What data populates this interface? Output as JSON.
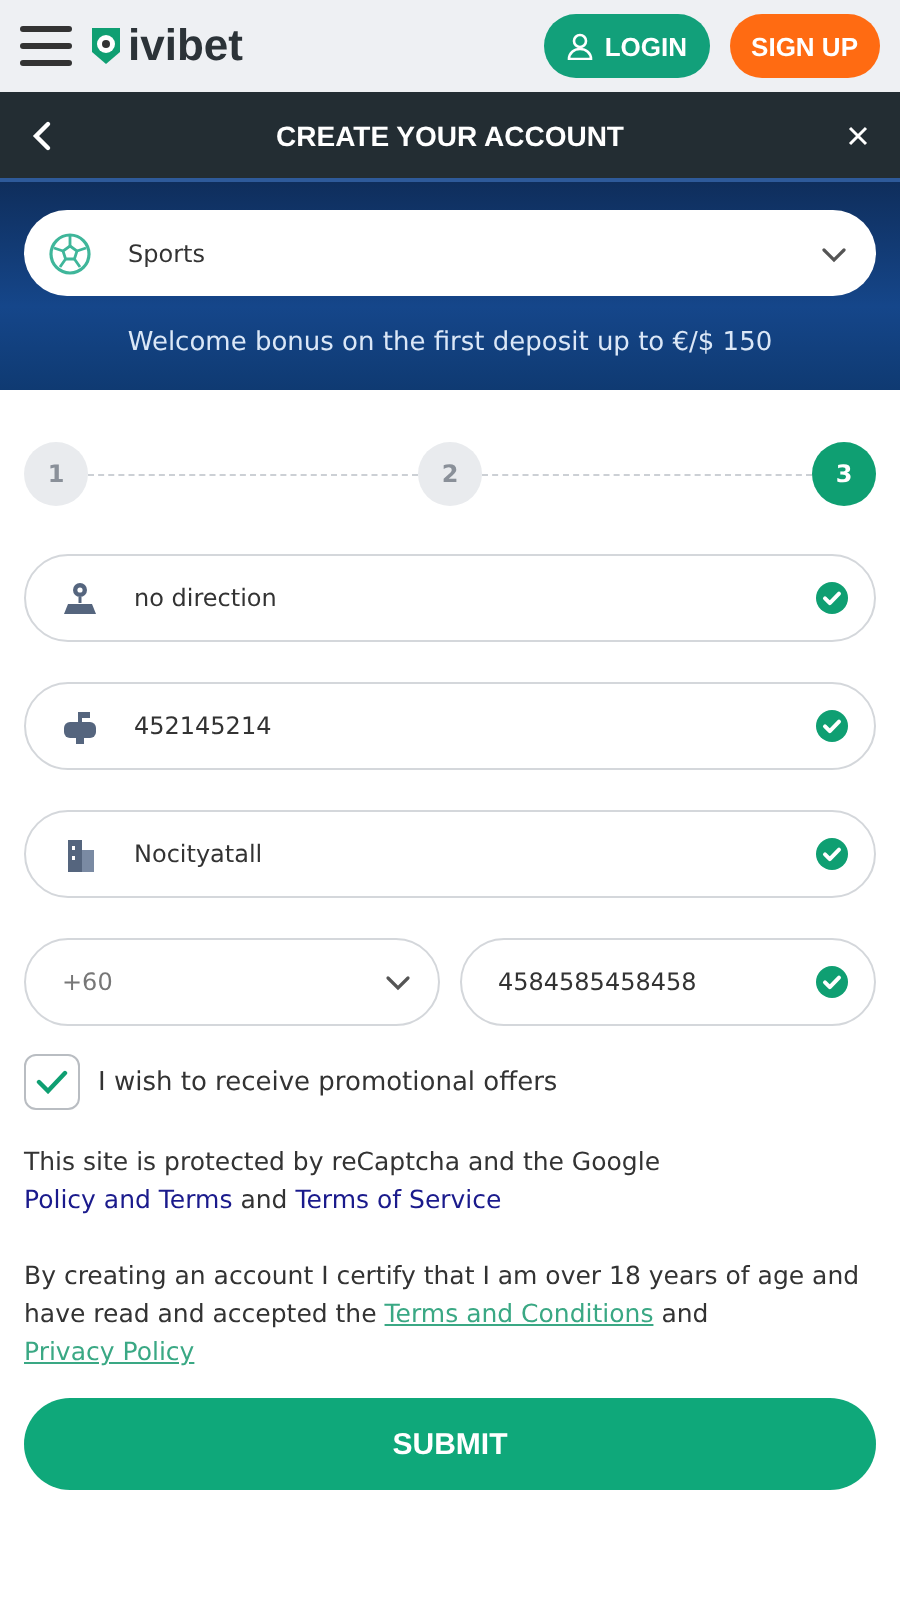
{
  "header": {
    "logo": "ivibet",
    "login": "LOGIN",
    "signup": "SIGN UP"
  },
  "title_bar": {
    "title": "CREATE YOUR ACCOUNT"
  },
  "bonus": {
    "select_value": "Sports",
    "text": "Welcome bonus on the first deposit up to €/$ 150"
  },
  "steps": [
    {
      "label": "1",
      "selected": false
    },
    {
      "label": "2",
      "selected": false
    },
    {
      "label": "3",
      "selected": true
    }
  ],
  "fields": [
    {
      "kind": "location",
      "value": "no direction",
      "valid": true
    },
    {
      "kind": "mailbox",
      "value": "452145214",
      "valid": true
    },
    {
      "kind": "building",
      "value": "Nocityatall",
      "valid": true
    }
  ],
  "phone": {
    "code": "+60",
    "number": "4584585458458",
    "valid": true
  },
  "promo": {
    "label": "I wish to receive promotional offers",
    "checked": true
  },
  "notices": [
    {
      "kind": "captcha",
      "parts": [
        {
          "kind": "text",
          "text": "This site is protected by reCaptcha and the Google "
        },
        {
          "kind": "link",
          "text": "Policy and Terms"
        },
        {
          "kind": "text",
          "text": " and "
        },
        {
          "kind": "link",
          "text": "Terms of Service"
        }
      ]
    },
    {
      "kind": "legal",
      "parts": [
        {
          "kind": "text",
          "text": "By creating an account I certify that I am over 18 years of age and have read and accepted the "
        },
        {
          "kind": "link",
          "text": "Terms and Conditions"
        },
        {
          "kind": "text",
          "text": " and "
        },
        {
          "kind": "link",
          "text": "Privacy Policy"
        }
      ]
    }
  ],
  "submit": "SUBMIT"
}
